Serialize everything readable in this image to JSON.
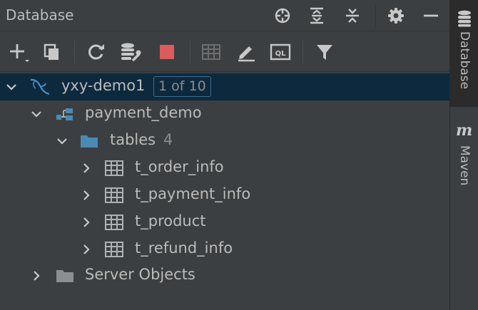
{
  "header": {
    "title": "Database",
    "buttons": [
      "crosshair-icon",
      "expand-all-icon",
      "collapse-all-icon",
      "gear-icon",
      "minimize-icon"
    ]
  },
  "toolbar": {
    "buttons": [
      "add-icon",
      "duplicate-icon",
      "refresh-icon",
      "data-source-properties-icon",
      "stop-icon",
      "table-editor-icon",
      "edit-icon",
      "query-console-icon",
      "filter-icon"
    ],
    "colors": {
      "stop": "#db5c5c"
    }
  },
  "tree": {
    "datasource": {
      "label": "yxy-demo1",
      "badge": "1 of 10"
    },
    "schema": {
      "label": "payment_demo"
    },
    "tables_folder": {
      "label": "tables",
      "count": "4"
    },
    "tables": [
      {
        "label": "t_order_info"
      },
      {
        "label": "t_payment_info"
      },
      {
        "label": "t_product"
      },
      {
        "label": "t_refund_info"
      }
    ],
    "server_objects": {
      "label": "Server Objects"
    }
  },
  "sidebar": {
    "tabs": [
      {
        "label": "Database",
        "icon": "database-icon"
      },
      {
        "label": "Maven",
        "icon": "maven-icon",
        "glyph": "m"
      }
    ]
  },
  "colors": {
    "panel_bg": "#3c3f41",
    "selection_bg": "#0d293e",
    "folder_blue": "#4a8ab3",
    "icon_grey": "#afb1b3"
  }
}
